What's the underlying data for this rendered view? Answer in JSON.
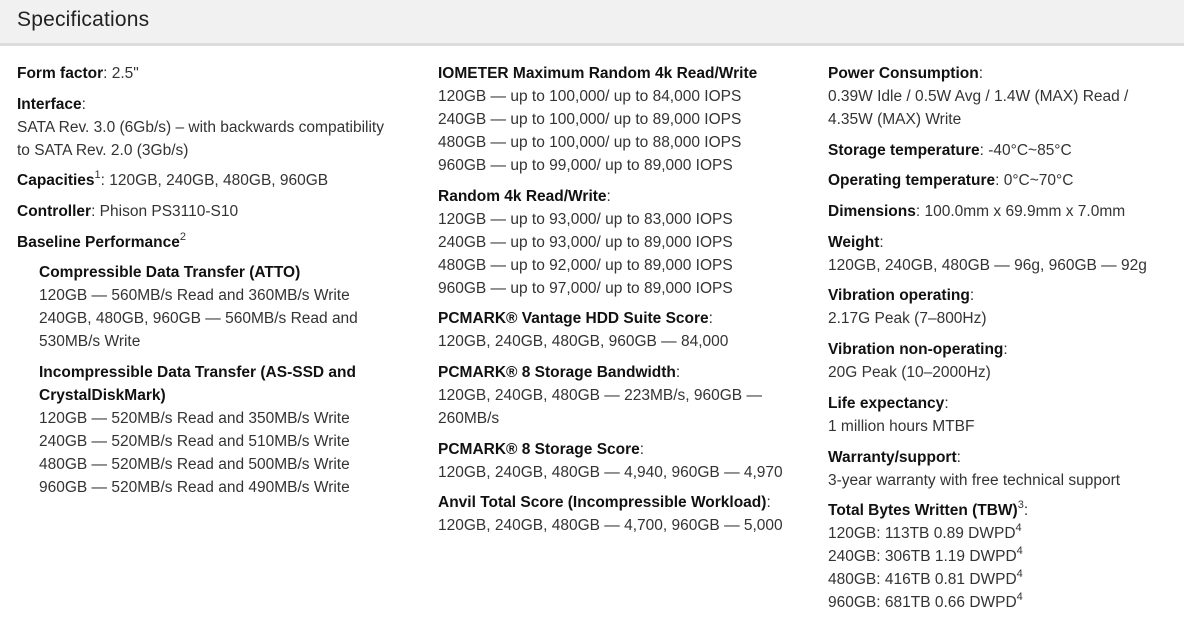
{
  "title": "Specifications",
  "col1": {
    "form_factor": {
      "label": "Form factor",
      "value": ": 2.5\""
    },
    "interface": {
      "label": "Interface",
      "sep": ":",
      "value": "SATA Rev. 3.0 (6Gb/s) – with backwards compatibility to SATA Rev. 2.0 (3Gb/s)"
    },
    "capacities": {
      "label": "Capacities",
      "sup": "1",
      "value": ": 120GB, 240GB, 480GB, 960GB"
    },
    "controller": {
      "label": "Controller",
      "value": ": Phison PS3110-S10"
    },
    "baseline": {
      "label": "Baseline Performance",
      "sup": "2"
    },
    "compressible": {
      "label": "Compressible Data Transfer (ATTO)",
      "lines": [
        "120GB — 560MB/s Read and 360MB/s Write",
        "240GB, 480GB, 960GB — 560MB/s Read and 530MB/s Write"
      ]
    },
    "incompressible": {
      "label": "Incompressible Data Transfer (AS-SSD and CrystalDiskMark)",
      "lines": [
        "120GB — 520MB/s Read and 350MB/s Write",
        "240GB — 520MB/s Read and 510MB/s Write",
        "480GB — 520MB/s Read and 500MB/s Write",
        "960GB — 520MB/s Read and 490MB/s Write"
      ]
    }
  },
  "col2": {
    "iometer": {
      "label": "IOMETER Maximum Random 4k Read/Write",
      "lines": [
        "120GB — up to 100,000/ up to 84,000 IOPS",
        "240GB — up to 100,000/ up to 89,000 IOPS",
        "480GB — up to 100,000/ up to 88,000 IOPS",
        "960GB — up to 99,000/ up to 89,000 IOPS"
      ]
    },
    "random4k": {
      "label": "Random 4k Read/Write",
      "sep": ":",
      "lines": [
        "120GB — up to 93,000/ up to 83,000 IOPS",
        "240GB — up to 93,000/ up to 89,000 IOPS",
        "480GB — up to 92,000/ up to 89,000 IOPS",
        "960GB — up to 97,000/ up to 89,000 IOPS"
      ]
    },
    "vantage": {
      "label": "PCMARK® Vantage HDD Suite Score",
      "sep": ":",
      "value": "120GB, 240GB, 480GB, 960GB — 84,000"
    },
    "bandwidth": {
      "label": "PCMARK® 8 Storage Bandwidth",
      "sep": ":",
      "value": "120GB, 240GB, 480GB — 223MB/s, 960GB — 260MB/s"
    },
    "storage_score": {
      "label": "PCMARK® 8 Storage Score",
      "sep": ":",
      "value": "120GB, 240GB, 480GB — 4,940, 960GB — 4,970"
    },
    "anvil": {
      "label": "Anvil Total Score (Incompressible Workload)",
      "sep": ":",
      "value": "120GB, 240GB, 480GB — 4,700, 960GB — 5,000"
    }
  },
  "col3": {
    "power": {
      "label": "Power Consumption",
      "sep": ":",
      "value": "0.39W Idle / 0.5W Avg / 1.4W (MAX) Read / 4.35W (MAX) Write"
    },
    "storage_temp": {
      "label": "Storage temperature",
      "value": ": -40°C~85°C"
    },
    "operating_temp": {
      "label": "Operating temperature",
      "value": ": 0°C~70°C"
    },
    "dimensions": {
      "label": "Dimensions",
      "value": ": 100.0mm x 69.9mm x 7.0mm"
    },
    "weight": {
      "label": "Weight",
      "sep": ":",
      "value": "120GB, 240GB, 480GB — 96g, 960GB — 92g"
    },
    "vib_op": {
      "label": "Vibration operating",
      "sep": ":",
      "value": "2.17G Peak (7–800Hz)"
    },
    "vib_nonop": {
      "label": "Vibration non-operating",
      "sep": ":",
      "value": "20G Peak (10–2000Hz)"
    },
    "life": {
      "label": "Life expectancy",
      "sep": ":",
      "value": "1 million hours MTBF"
    },
    "warranty": {
      "label": "Warranty/support",
      "sep": ":",
      "value": "3-year warranty with free technical support"
    },
    "tbw": {
      "label": "Total Bytes Written (TBW)",
      "sup": "3",
      "sep": ":",
      "items": [
        {
          "text": "120GB: 113TB 0.89 DWPD",
          "sup": "4"
        },
        {
          "text": "240GB: 306TB 1.19 DWPD",
          "sup": "4"
        },
        {
          "text": "480GB: 416TB 0.81 DWPD",
          "sup": "4"
        },
        {
          "text": "960GB: 681TB 0.66 DWPD",
          "sup": "4"
        }
      ]
    }
  }
}
